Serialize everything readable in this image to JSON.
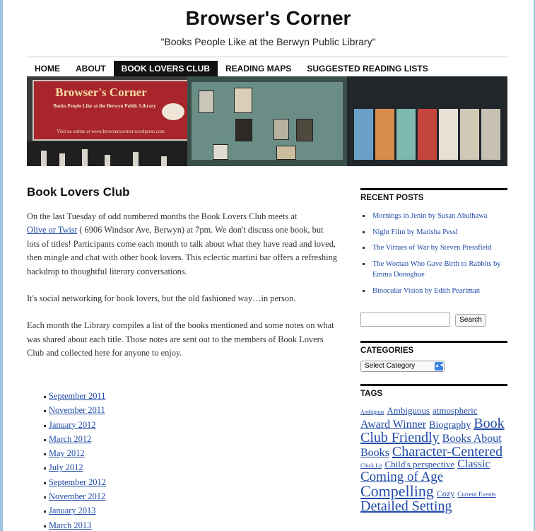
{
  "site": {
    "title": "Browser's Corner",
    "tagline": "\"Books People Like at the Berwyn Public Library\""
  },
  "nav": {
    "items": [
      "HOME",
      "ABOUT",
      "BOOK LOVERS CLUB",
      "READING MAPS",
      "SUGGESTED READING LISTS"
    ],
    "active": "BOOK LOVERS CLUB"
  },
  "banner": {
    "sign_title": "Browser's Corner",
    "sign_subtitle": "Books People Like at the Berwyn Public Library",
    "sign_url": "Visit us online at www.browserscorner.wordpress.com"
  },
  "post": {
    "title": "Book Lovers Club",
    "p1_a": "On the last Tuesday of odd numbered months the Book Lovers Club meets at",
    "p1_link": "Olive or Twist",
    "p1_b": " ( 6906 Windsor Ave, Berwyn) at 7pm.  We don't discuss one book, but lots of titles! Participants come each month to talk about what they have read and loved, then mingle and chat with other book lovers. This eclectic martini bar offers a refreshing backdrop to thoughtful literary conversations.",
    "p2": "It's social networking for book lovers, but the old fashioned way…in person.",
    "p3": "Each month the Library compiles a list of the books mentioned and some notes on what was shared about each title.  Those notes are sent out to the members of Book Lovers Club and collected here for anyone to enjoy.",
    "months": [
      "September 2011",
      "November 2011",
      "January 2012",
      "March 2012",
      "May 2012",
      "July 2012",
      "September 2012",
      "November 2012",
      "January 2013",
      "March 2013"
    ]
  },
  "sidebar": {
    "recent_posts_heading": "RECENT POSTS",
    "recent_posts": [
      "Mornings in Jenin by Susan Abulhawa",
      "Night Film by Marisha Pessl",
      "The Virtues of War by Steven Pressfield",
      "The Woman Who Gave Birth to Rabbits by Emma Donoghue",
      "Binocular Vision by Edith Pearlman"
    ],
    "search_button": "Search",
    "categories_heading": "CATEGORIES",
    "categories_selected": "Select Category",
    "tags_heading": "TAGS",
    "tags": [
      {
        "label": "Ambigous",
        "size": 8
      },
      {
        "label": "Ambiguous",
        "size": 13
      },
      {
        "label": "atmospheric",
        "size": 13
      },
      {
        "label": "Award Winner",
        "size": 16
      },
      {
        "label": "Biography",
        "size": 14
      },
      {
        "label": "Book Club Friendly",
        "size": 20
      },
      {
        "label": "Books About Books",
        "size": 16
      },
      {
        "label": "Character-Centered",
        "size": 20
      },
      {
        "label": "Chick Lit",
        "size": 8
      },
      {
        "label": "Child's perspective",
        "size": 13
      },
      {
        "label": "Classic",
        "size": 16
      },
      {
        "label": "Coming of Age",
        "size": 19
      },
      {
        "label": "Compelling",
        "size": 22
      },
      {
        "label": "Cozy",
        "size": 12
      },
      {
        "label": "Current Events",
        "size": 9
      },
      {
        "label": "Detailed Setting",
        "size": 20
      }
    ]
  },
  "colors": {
    "link": "#1f4aa6",
    "nav_active_bg": "#111111",
    "frame": "#9cc3e6"
  }
}
